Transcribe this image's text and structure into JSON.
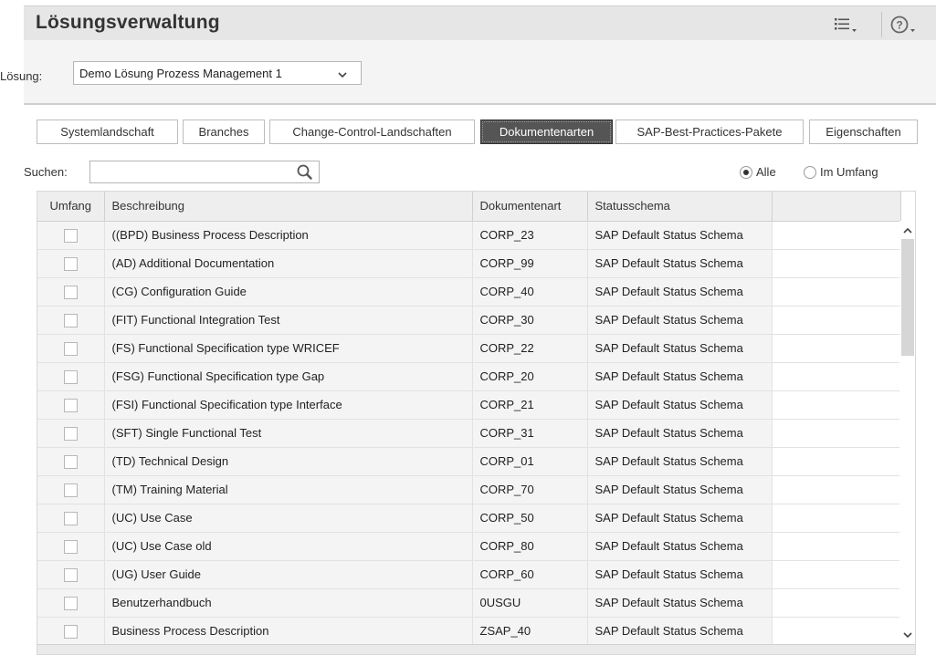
{
  "app": {
    "title": "Lösungsverwaltung"
  },
  "header": {
    "solution_label": "Lösung:",
    "solution_value": "Demo Lösung Prozess Management 1"
  },
  "tabs": [
    {
      "label": "Systemlandschaft"
    },
    {
      "label": "Branches"
    },
    {
      "label": "Change-Control-Landschaften"
    },
    {
      "label": "Dokumentenarten"
    },
    {
      "label": "SAP-Best-Practices-Pakete"
    },
    {
      "label": "Eigenschaften"
    }
  ],
  "active_tab": "Dokumentenarten",
  "search": {
    "label": "Suchen:",
    "value": ""
  },
  "filter": {
    "all_label": "Alle",
    "in_scope_label": "Im Umfang",
    "selected": "Alle"
  },
  "table": {
    "headers": [
      "Umfang",
      "Beschreibung",
      "Dokumentenart",
      "Statusschema"
    ],
    "rows": [
      {
        "desc": "((BPD) Business Process Description",
        "type": "CORP_23",
        "status": "SAP Default Status Schema"
      },
      {
        "desc": "(AD) Additional Documentation",
        "type": "CORP_99",
        "status": "SAP Default Status Schema"
      },
      {
        "desc": "(CG) Configuration Guide",
        "type": "CORP_40",
        "status": "SAP Default Status Schema"
      },
      {
        "desc": "(FIT) Functional Integration Test",
        "type": "CORP_30",
        "status": "SAP Default Status Schema"
      },
      {
        "desc": "(FS) Functional Specification type WRICEF",
        "type": "CORP_22",
        "status": "SAP Default Status Schema"
      },
      {
        "desc": "(FSG) Functional Specification type Gap",
        "type": "CORP_20",
        "status": "SAP Default Status Schema"
      },
      {
        "desc": "(FSI) Functional Specification type Interface",
        "type": "CORP_21",
        "status": "SAP Default Status Schema"
      },
      {
        "desc": "(SFT) Single Functional Test",
        "type": "CORP_31",
        "status": "SAP Default Status Schema"
      },
      {
        "desc": "(TD) Technical Design",
        "type": "CORP_01",
        "status": "SAP Default Status Schema"
      },
      {
        "desc": "(TM) Training Material",
        "type": "CORP_70",
        "status": "SAP Default Status Schema"
      },
      {
        "desc": "(UC) Use Case",
        "type": "CORP_50",
        "status": "SAP Default Status Schema"
      },
      {
        "desc": "(UC) Use Case old",
        "type": "CORP_80",
        "status": "SAP Default Status Schema"
      },
      {
        "desc": "(UG) User Guide",
        "type": "CORP_60",
        "status": "SAP Default Status Schema"
      },
      {
        "desc": "Benutzerhandbuch",
        "type": "0USGU",
        "status": "SAP Default Status Schema"
      },
      {
        "desc": "Business Process Description",
        "type": "ZSAP_40",
        "status": "SAP Default Status Schema"
      }
    ]
  },
  "icons": {
    "list": "list-settings-icon",
    "help": "help-icon",
    "search": "search-icon",
    "dropdown": "chevron-down-icon"
  }
}
